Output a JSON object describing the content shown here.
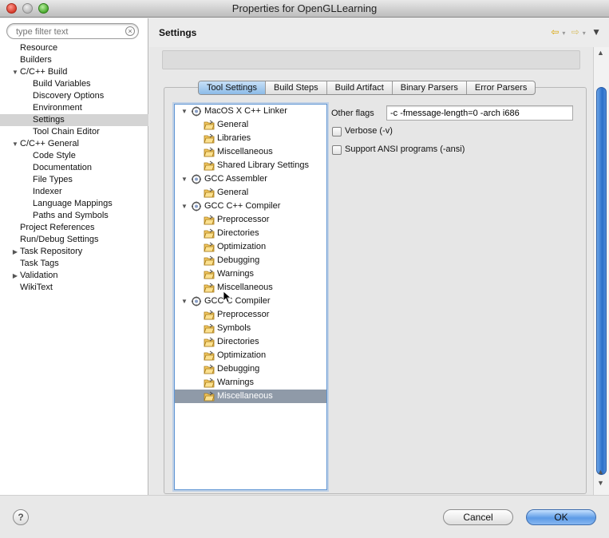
{
  "window": {
    "title": "Properties for OpenGLLearning"
  },
  "filter": {
    "placeholder": "type filter text"
  },
  "left_tree": [
    {
      "label": "Resource",
      "level": 0
    },
    {
      "label": "Builders",
      "level": 0
    },
    {
      "label": "C/C++ Build",
      "level": 0,
      "expanded": true
    },
    {
      "label": "Build Variables",
      "level": 1
    },
    {
      "label": "Discovery Options",
      "level": 1
    },
    {
      "label": "Environment",
      "level": 1
    },
    {
      "label": "Settings",
      "level": 1,
      "selected": true
    },
    {
      "label": "Tool Chain Editor",
      "level": 1
    },
    {
      "label": "C/C++ General",
      "level": 0,
      "expanded": true
    },
    {
      "label": "Code Style",
      "level": 1
    },
    {
      "label": "Documentation",
      "level": 1
    },
    {
      "label": "File Types",
      "level": 1
    },
    {
      "label": "Indexer",
      "level": 1
    },
    {
      "label": "Language Mappings",
      "level": 1
    },
    {
      "label": "Paths and Symbols",
      "level": 1
    },
    {
      "label": "Project References",
      "level": 0
    },
    {
      "label": "Run/Debug Settings",
      "level": 0
    },
    {
      "label": "Task Repository",
      "level": 0,
      "collapsed": true
    },
    {
      "label": "Task Tags",
      "level": 0
    },
    {
      "label": "Validation",
      "level": 0,
      "collapsed": true
    },
    {
      "label": "WikiText",
      "level": 0
    }
  ],
  "page": {
    "title": "Settings"
  },
  "tabs": [
    {
      "label": "Tool Settings",
      "active": true
    },
    {
      "label": "Build Steps"
    },
    {
      "label": "Build Artifact"
    },
    {
      "label": "Binary Parsers"
    },
    {
      "label": "Error Parsers"
    }
  ],
  "tool_tree": [
    {
      "label": "MacOS X C++ Linker",
      "tool": true
    },
    {
      "label": "General"
    },
    {
      "label": "Libraries"
    },
    {
      "label": "Miscellaneous"
    },
    {
      "label": "Shared Library Settings"
    },
    {
      "label": "GCC Assembler",
      "tool": true
    },
    {
      "label": "General"
    },
    {
      "label": "GCC C++ Compiler",
      "tool": true
    },
    {
      "label": "Preprocessor"
    },
    {
      "label": "Directories"
    },
    {
      "label": "Optimization"
    },
    {
      "label": "Debugging"
    },
    {
      "label": "Warnings"
    },
    {
      "label": "Miscellaneous"
    },
    {
      "label": "GCC C Compiler",
      "tool": true
    },
    {
      "label": "Preprocessor"
    },
    {
      "label": "Symbols"
    },
    {
      "label": "Directories"
    },
    {
      "label": "Optimization"
    },
    {
      "label": "Debugging"
    },
    {
      "label": "Warnings"
    },
    {
      "label": "Miscellaneous",
      "selected": true
    }
  ],
  "settings": {
    "other_flags_label": "Other flags",
    "other_flags_value": "-c -fmessage-length=0 -arch i686",
    "verbose_label": "Verbose (-v)",
    "ansi_label": "Support ANSI programs (-ansi)"
  },
  "buttons": {
    "cancel": "Cancel",
    "ok": "OK",
    "help": "?"
  },
  "colors": {
    "accent": "#5d9be6",
    "selection": "#8f9aa8"
  }
}
